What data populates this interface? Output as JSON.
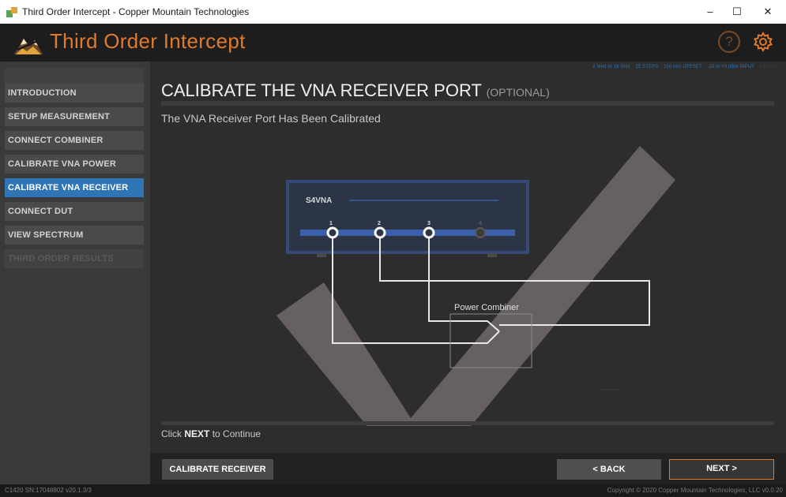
{
  "window": {
    "title": "Third Order Intercept - Copper Mountain Technologies",
    "minimize": "–",
    "maximize": "☐",
    "close": "✕"
  },
  "header": {
    "title": "Third Order Intercept",
    "help_glyph": "?",
    "logo_icon": "mountain-logo-icon",
    "settings_icon": "gear-icon",
    "accent_color": "#e07a2c"
  },
  "sidebar": {
    "items": [
      {
        "label": "INTRODUCTION",
        "state": "normal"
      },
      {
        "label": "SETUP MEASUREMENT",
        "state": "normal"
      },
      {
        "label": "CONNECT COMBINER",
        "state": "normal"
      },
      {
        "label": "CALIBRATE VNA POWER",
        "state": "normal"
      },
      {
        "label": "CALIBRATE VNA RECEIVER",
        "state": "active"
      },
      {
        "label": "CONNECT DUT",
        "state": "normal"
      },
      {
        "label": "VIEW SPECTRUM",
        "state": "normal"
      },
      {
        "label": "THIRD ORDER RESULTS",
        "state": "disabled"
      }
    ],
    "active_color": "#2f74b5"
  },
  "main": {
    "params": {
      "range": "2 MHz to 18 GHz",
      "steps": "25 STEPS",
      "offset": "100 kHz OFFSET",
      "input": "-10 to +0 dBm INPUT",
      "extra": "STATUS"
    },
    "title": "CALIBRATE THE VNA RECEIVER PORT",
    "title_suffix": "(OPTIONAL)",
    "subtitle": "The VNA Receiver Port Has Been Calibrated",
    "diagram": {
      "device_label": "S4VNA",
      "ports": [
        "1",
        "2",
        "3",
        "4"
      ],
      "combiner_label": "Power Combiner"
    },
    "footer_prefix": "Click",
    "footer_bold": "NEXT",
    "footer_suffix": "to Continue"
  },
  "buttons": {
    "calibrate": "CALIBRATE RECEIVER",
    "back": "< BACK",
    "next": "NEXT >"
  },
  "status": {
    "left": "C1420  SN:17048802  v20.1.3/3",
    "right": "Copyright © 2020 Copper Mountain Technologies, LLC v0.0.20"
  }
}
